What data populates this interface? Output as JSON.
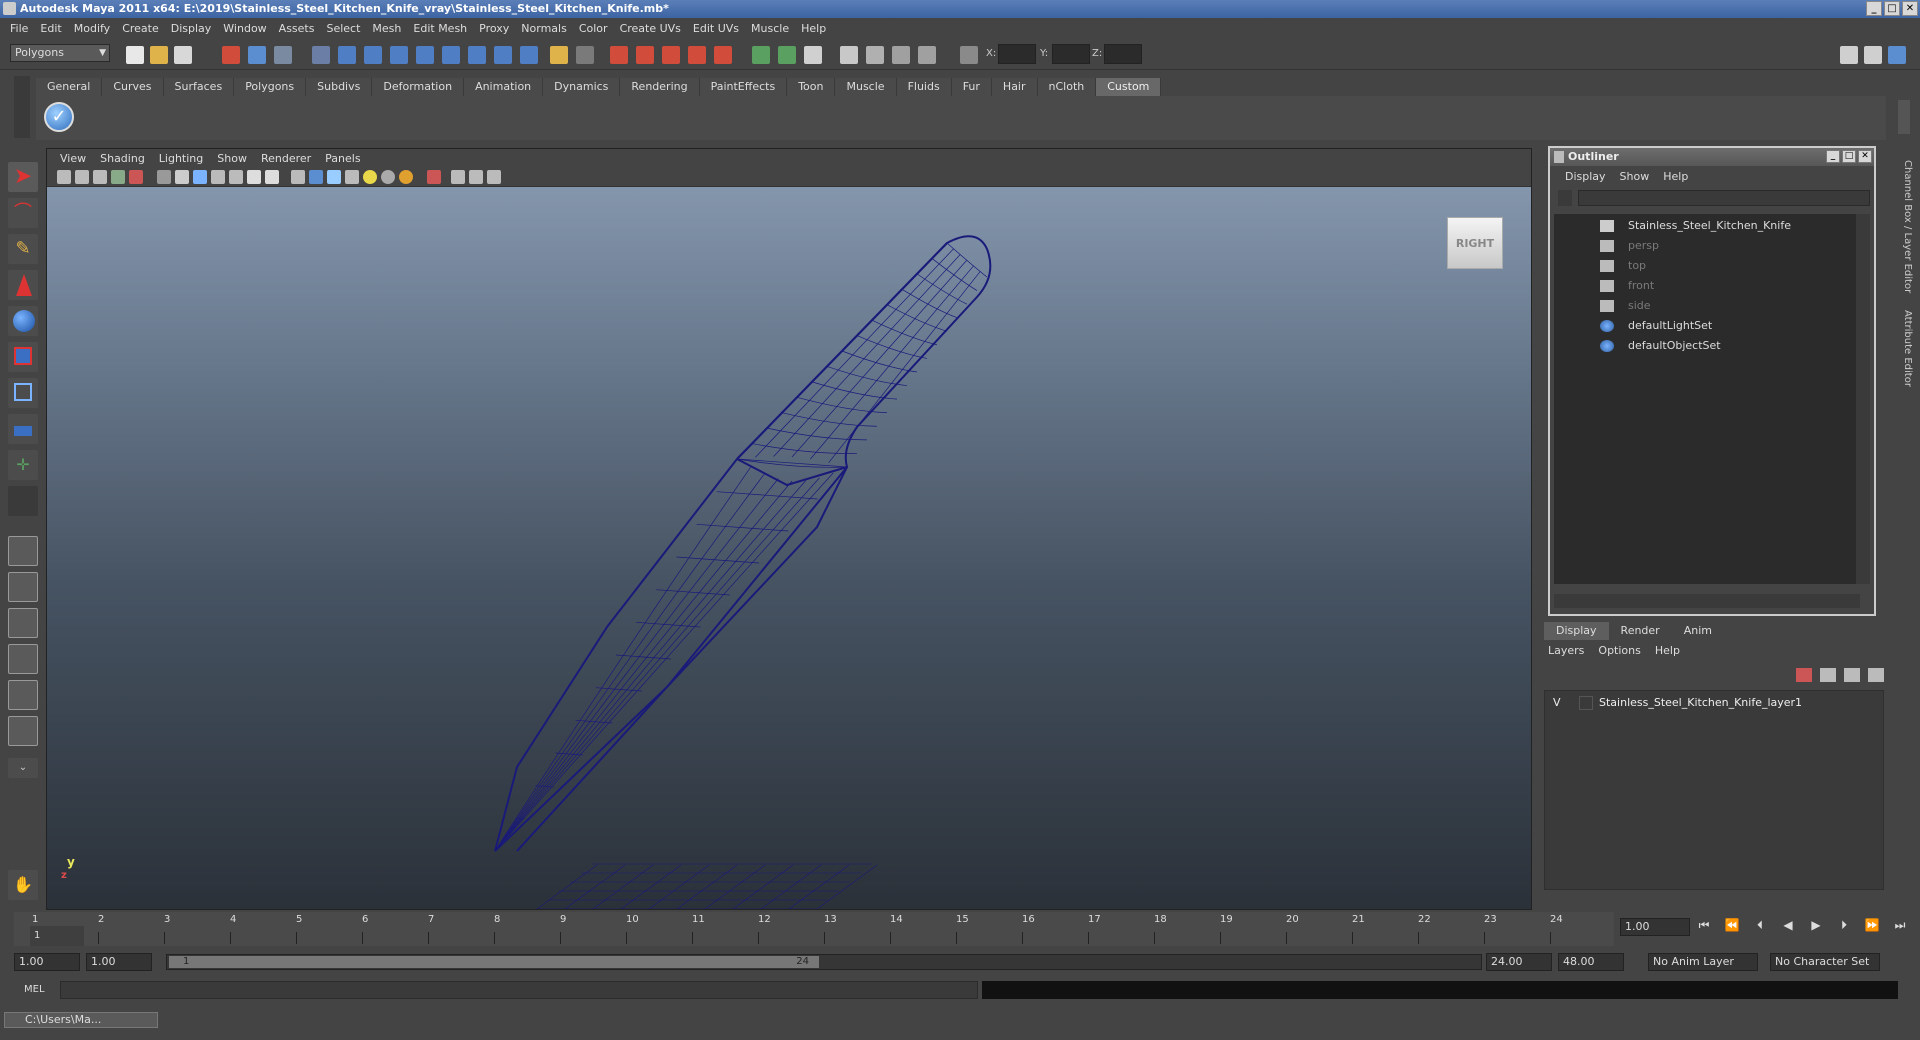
{
  "window": {
    "title": "Autodesk Maya 2011 x64: E:\\2019\\Stainless_Steel_Kitchen_Knife_vray\\Stainless_Steel_Kitchen_Knife.mb*",
    "minimize": "_",
    "maximize": "□",
    "close": "✕"
  },
  "menubar": [
    "File",
    "Edit",
    "Modify",
    "Create",
    "Display",
    "Window",
    "Assets",
    "Select",
    "Mesh",
    "Edit Mesh",
    "Proxy",
    "Normals",
    "Color",
    "Create UVs",
    "Edit UVs",
    "Muscle",
    "Help"
  ],
  "statusline": {
    "mode": "Polygons",
    "x_label": "X:",
    "y_label": "Y:",
    "z_label": "Z:"
  },
  "shelf": {
    "tabs": [
      "General",
      "Curves",
      "Surfaces",
      "Polygons",
      "Subdivs",
      "Deformation",
      "Animation",
      "Dynamics",
      "Rendering",
      "PaintEffects",
      "Toon",
      "Muscle",
      "Fluids",
      "Fur",
      "Hair",
      "nCloth",
      "Custom"
    ],
    "active_tab": "Custom"
  },
  "viewport": {
    "menu": [
      "View",
      "Shading",
      "Lighting",
      "Show",
      "Renderer",
      "Panels"
    ],
    "viewcube_label": "RIGHT",
    "axis_y": "y",
    "axis_x": "z",
    "wire_color": "#1a1a7a"
  },
  "outliner": {
    "title": "Outliner",
    "menu": [
      "Display",
      "Show",
      "Help"
    ],
    "items": [
      {
        "label": "Stainless_Steel_Kitchen_Knife",
        "dim": false,
        "icon": "mesh-transform-icon"
      },
      {
        "label": "persp",
        "dim": true,
        "icon": "camera-icon"
      },
      {
        "label": "top",
        "dim": true,
        "icon": "camera-icon"
      },
      {
        "label": "front",
        "dim": true,
        "icon": "camera-icon"
      },
      {
        "label": "side",
        "dim": true,
        "icon": "camera-icon"
      },
      {
        "label": "defaultLightSet",
        "dim": false,
        "icon": "set-icon"
      },
      {
        "label": "defaultObjectSet",
        "dim": false,
        "icon": "set-icon"
      }
    ]
  },
  "layers": {
    "tabs": [
      "Display",
      "Render",
      "Anim"
    ],
    "active_tab": "Display",
    "menu": [
      "Layers",
      "Options",
      "Help"
    ],
    "rows": [
      {
        "visible": "V",
        "name": "Stainless_Steel_Kitchen_Knife_layer1"
      }
    ]
  },
  "side_tabs": [
    "Channel Box / Layer Editor",
    "Attribute Editor"
  ],
  "timeline": {
    "frames": [
      "1",
      "2",
      "3",
      "4",
      "5",
      "6",
      "7",
      "8",
      "9",
      "10",
      "11",
      "12",
      "13",
      "14",
      "15",
      "16",
      "17",
      "18",
      "19",
      "20",
      "21",
      "22",
      "23",
      "24"
    ],
    "current_marker": "1",
    "current_frame": "1.00"
  },
  "range": {
    "start_time": "1.00",
    "start_range": "1.00",
    "range_min_label": "1",
    "range_max_label": "24",
    "end_range": "24.00",
    "end_time": "48.00",
    "anim_layer": "No Anim Layer",
    "character_set": "No Character Set"
  },
  "cmdline": {
    "label": "MEL"
  },
  "taskbar": {
    "item": "C:\\Users\\Ma..."
  }
}
